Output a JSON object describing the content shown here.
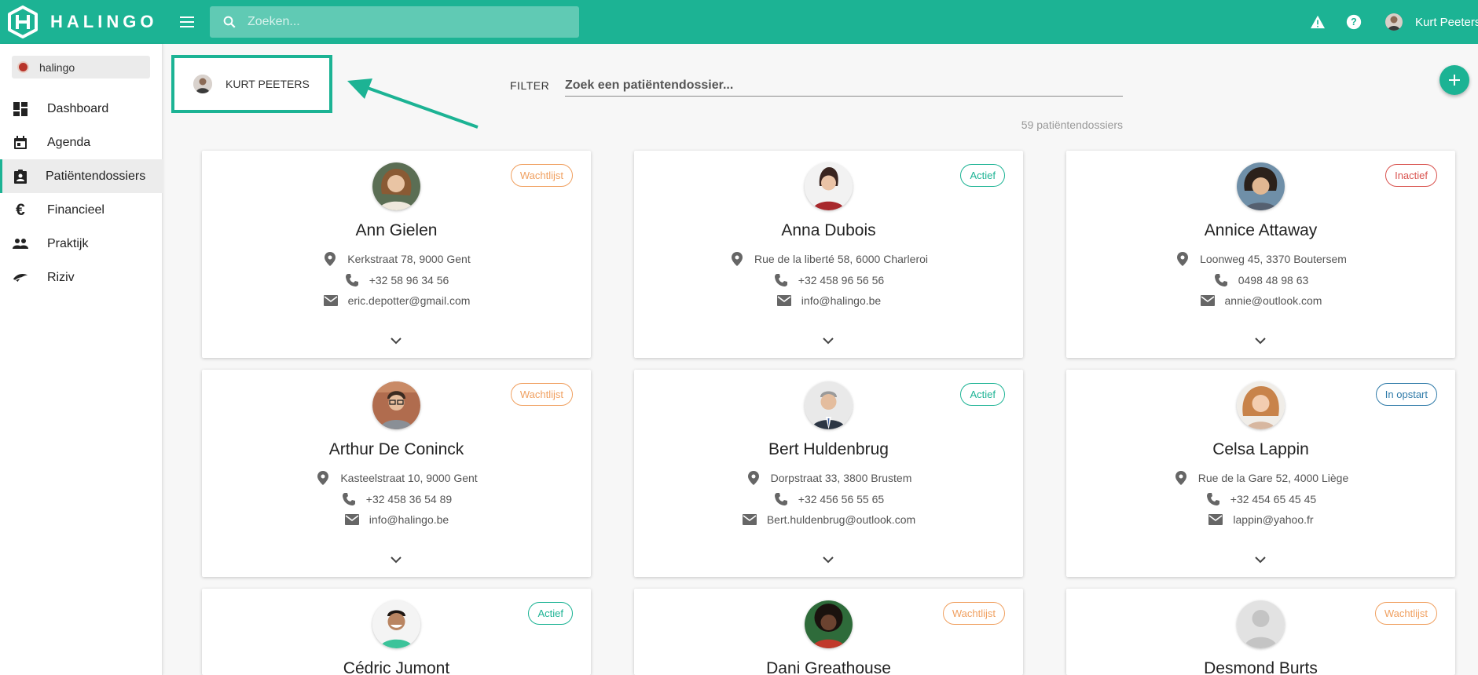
{
  "brand": {
    "name": "HALINGO",
    "accent": "#1cb394"
  },
  "search": {
    "placeholder": "Zoeken..."
  },
  "topbar": {
    "user_name": "Kurt Peeters",
    "icons": [
      "warning-icon",
      "help-icon"
    ]
  },
  "sidebar": {
    "organization": "halingo",
    "items": [
      {
        "label": "Dashboard",
        "icon": "dashboard-icon",
        "active": false
      },
      {
        "label": "Agenda",
        "icon": "calendar-icon",
        "active": false
      },
      {
        "label": "Patiëntendossiers",
        "icon": "clipboard-account-icon",
        "active": true
      },
      {
        "label": "Financieel",
        "icon": "euro-icon",
        "active": false
      },
      {
        "label": "Praktijk",
        "icon": "people-icon",
        "active": false
      },
      {
        "label": "Riziv",
        "icon": "riziv-icon",
        "active": false
      }
    ]
  },
  "main": {
    "person_label": "KURT PEETERS",
    "filter": {
      "label": "FILTER",
      "placeholder": "Zoek een patiëntendossier..."
    },
    "count_text": "59 patiëntendossiers",
    "patients": [
      {
        "name": "Ann Gielen",
        "status": "Wachtlijst",
        "address": "Kerkstraat 78, 9000 Gent",
        "phone": "+32 58 96 34 56",
        "email": "eric.depotter@gmail.com"
      },
      {
        "name": "Anna Dubois",
        "status": "Actief",
        "address": "Rue de la liberté 58, 6000 Charleroi",
        "phone": "+32 458 96 56 56",
        "email": "info@halingo.be"
      },
      {
        "name": "Annice Attaway",
        "status": "Inactief",
        "address": "Loonweg 45, 3370 Boutersem",
        "phone": "0498 48 98 63",
        "email": "annie@outlook.com"
      },
      {
        "name": "Arthur De Coninck",
        "status": "Wachtlijst",
        "address": "Kasteelstraat 10, 9000 Gent",
        "phone": "+32 458 36 54 89",
        "email": "info@halingo.be"
      },
      {
        "name": "Bert Huldenbrug",
        "status": "Actief",
        "address": "Dorpstraat 33, 3800 Brustem",
        "phone": "+32 456 56 55 65",
        "email": "Bert.huldenbrug@outlook.com"
      },
      {
        "name": "Celsa Lappin",
        "status": "In opstart",
        "address": "Rue de la Gare 52, 4000 Liège",
        "phone": "+32 454 65 45 45",
        "email": "lappin@yahoo.fr"
      },
      {
        "name": "Cédric Jumont",
        "status": "Actief"
      },
      {
        "name": "Dani Greathouse",
        "status": "Wachtlijst"
      },
      {
        "name": "Desmond Burts",
        "status": "Wachtlijst"
      }
    ]
  }
}
